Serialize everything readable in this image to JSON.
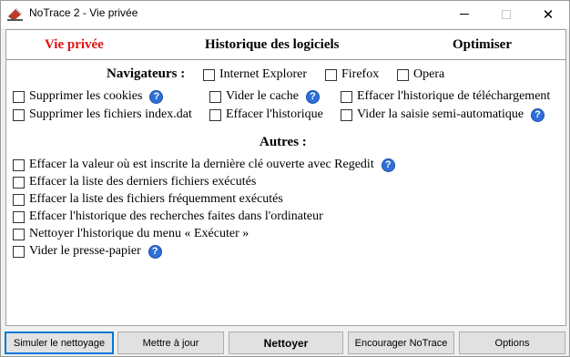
{
  "window": {
    "title": "NoTrace 2 - Vie privée"
  },
  "tabs": [
    {
      "label": "Vie privée",
      "active": true
    },
    {
      "label": "Historique des logiciels",
      "active": false
    },
    {
      "label": "Optimiser",
      "active": false
    }
  ],
  "browsers": {
    "heading": "Navigateurs :",
    "options": [
      {
        "label": "Internet Explorer",
        "checked": false
      },
      {
        "label": "Firefox",
        "checked": false
      },
      {
        "label": "Opera",
        "checked": false
      }
    ]
  },
  "browser_actions": [
    {
      "label": "Supprimer les cookies",
      "checked": false,
      "help": true
    },
    {
      "label": "Vider le cache",
      "checked": false,
      "help": true
    },
    {
      "label": "Effacer l'historique de téléchargement",
      "checked": false,
      "help": false
    },
    {
      "label": "Supprimer les fichiers index.dat",
      "checked": false,
      "help": false
    },
    {
      "label": "Effacer l'historique",
      "checked": false,
      "help": false
    },
    {
      "label": "Vider la saisie semi-automatique",
      "checked": false,
      "help": true
    }
  ],
  "others": {
    "heading": "Autres :",
    "items": [
      {
        "label": "Effacer la valeur où est inscrite la dernière clé ouverte avec Regedit",
        "checked": false,
        "help": true
      },
      {
        "label": "Effacer la liste des derniers fichiers exécutés",
        "checked": false,
        "help": false
      },
      {
        "label": "Effacer la liste des fichiers fréquemment exécutés",
        "checked": false,
        "help": false
      },
      {
        "label": "Effacer l'historique des recherches faites dans l'ordinateur",
        "checked": false,
        "help": false
      },
      {
        "label": "Nettoyer l'historique du menu « Exécuter »",
        "checked": false,
        "help": false
      },
      {
        "label": "Vider le presse-papier",
        "checked": false,
        "help": true
      }
    ]
  },
  "help_glyph": "?",
  "buttons": {
    "simulate": "Simuler le nettoyage",
    "update": "Mettre à jour",
    "clean": "Nettoyer",
    "encourage": "Encourager NoTrace",
    "options": "Options"
  },
  "colors": {
    "active_tab": "#e01010",
    "help_icon": "#2f6fd8",
    "default_button_border": "#0078d7"
  }
}
